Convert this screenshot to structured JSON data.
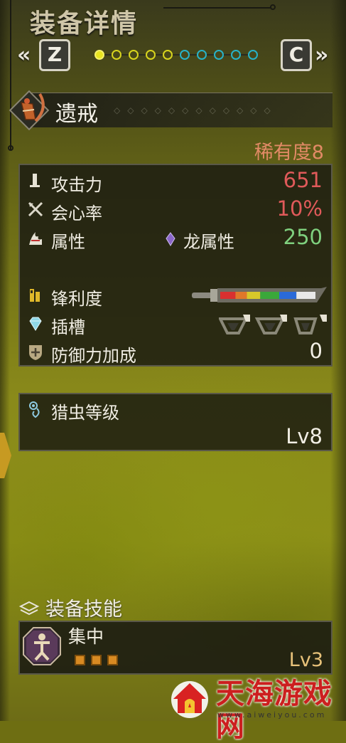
{
  "header": {
    "title": "装备详情",
    "prev_arrow": "«",
    "next_arrow": "»",
    "prev_key": "Z",
    "next_key": "C",
    "pages": [
      {
        "color": "yellow",
        "active": true
      },
      {
        "color": "yellow",
        "active": false
      },
      {
        "color": "yellow",
        "active": false
      },
      {
        "color": "yellow",
        "active": false
      },
      {
        "color": "yellow",
        "active": false
      },
      {
        "color": "cyan",
        "active": false
      },
      {
        "color": "cyan",
        "active": false
      },
      {
        "color": "cyan",
        "active": false
      },
      {
        "color": "cyan",
        "active": false
      },
      {
        "color": "cyan",
        "active": false
      }
    ]
  },
  "weapon": {
    "name": "遗戒",
    "rarity": "稀有度8",
    "icon": "insect-glaive-icon"
  },
  "stats": {
    "attack": {
      "label": "攻击力",
      "value": "651",
      "icon": "sword-icon"
    },
    "affinity": {
      "label": "会心率",
      "value": "10%",
      "icon": "crossed-swords-icon"
    },
    "element": {
      "label": "属性",
      "type": "龙属性",
      "value": "250",
      "icon": "element-icon",
      "type_icon": "dragon-crystal-icon"
    },
    "sharpness": {
      "label": "锋利度",
      "icon": "sharpness-icon",
      "segments": [
        {
          "color": "#d83030",
          "share": 0.16
        },
        {
          "color": "#e0782a",
          "share": 0.12
        },
        {
          "color": "#d8c82a",
          "share": 0.14
        },
        {
          "color": "#3aa83a",
          "share": 0.2
        },
        {
          "color": "#2a6ad8",
          "share": 0.18
        },
        {
          "color": "#e8e8e8",
          "share": 0.2
        }
      ]
    },
    "slots": {
      "label": "插槽",
      "icon": "gem-icon",
      "slot_icons": [
        "decoration-slot-icon",
        "decoration-slot-icon",
        "decoration-slot-icon"
      ]
    },
    "defense": {
      "label": "防御力加成",
      "value": "0",
      "icon": "shield-icon"
    }
  },
  "kinsect": {
    "label": "猎虫等级",
    "value": "Lv8",
    "icon": "kinsect-icon"
  },
  "skills": {
    "heading": "装备技能",
    "heading_icon": "skills-icon",
    "items": [
      {
        "name": "集中",
        "level": "Lv3",
        "pips_filled": 3,
        "icon": "focus-skill-icon"
      }
    ]
  },
  "watermark": {
    "title": "天海游戏网",
    "url": "www.aiweiyou.com"
  }
}
